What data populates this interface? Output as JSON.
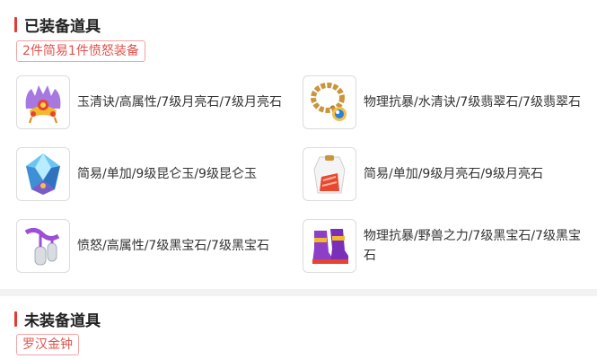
{
  "equipped": {
    "title": "已装备道具",
    "set_tag": "2件简易1件愤怒装备",
    "items": [
      {
        "icon": "golden-headdress-icon",
        "stats": "玉清诀/高属性/7级月亮石/7级月亮石"
      },
      {
        "icon": "bead-necklace-icon",
        "stats": "物理抗暴/水清诀/7级翡翠石/7级翡翠石"
      },
      {
        "icon": "crystal-armor-icon",
        "stats": "简易/单加/9级昆仑玉/9级昆仑玉"
      },
      {
        "icon": "white-robe-icon",
        "stats": "简易/单加/9级月亮石/9级月亮石"
      },
      {
        "icon": "purple-belt-icon",
        "stats": "愤怒/高属性/7级黑宝石/7级黑宝石"
      },
      {
        "icon": "purple-boots-icon",
        "stats": "物理抗暴/野兽之力/7级黑宝石/7级黑宝石"
      }
    ]
  },
  "unequipped": {
    "title": "未装备道具",
    "item_tag": "罗汉金钟"
  },
  "colors": {
    "accent": "#e53935",
    "tag_border": "#f3a4a4",
    "tag_text": "#e0534d"
  }
}
